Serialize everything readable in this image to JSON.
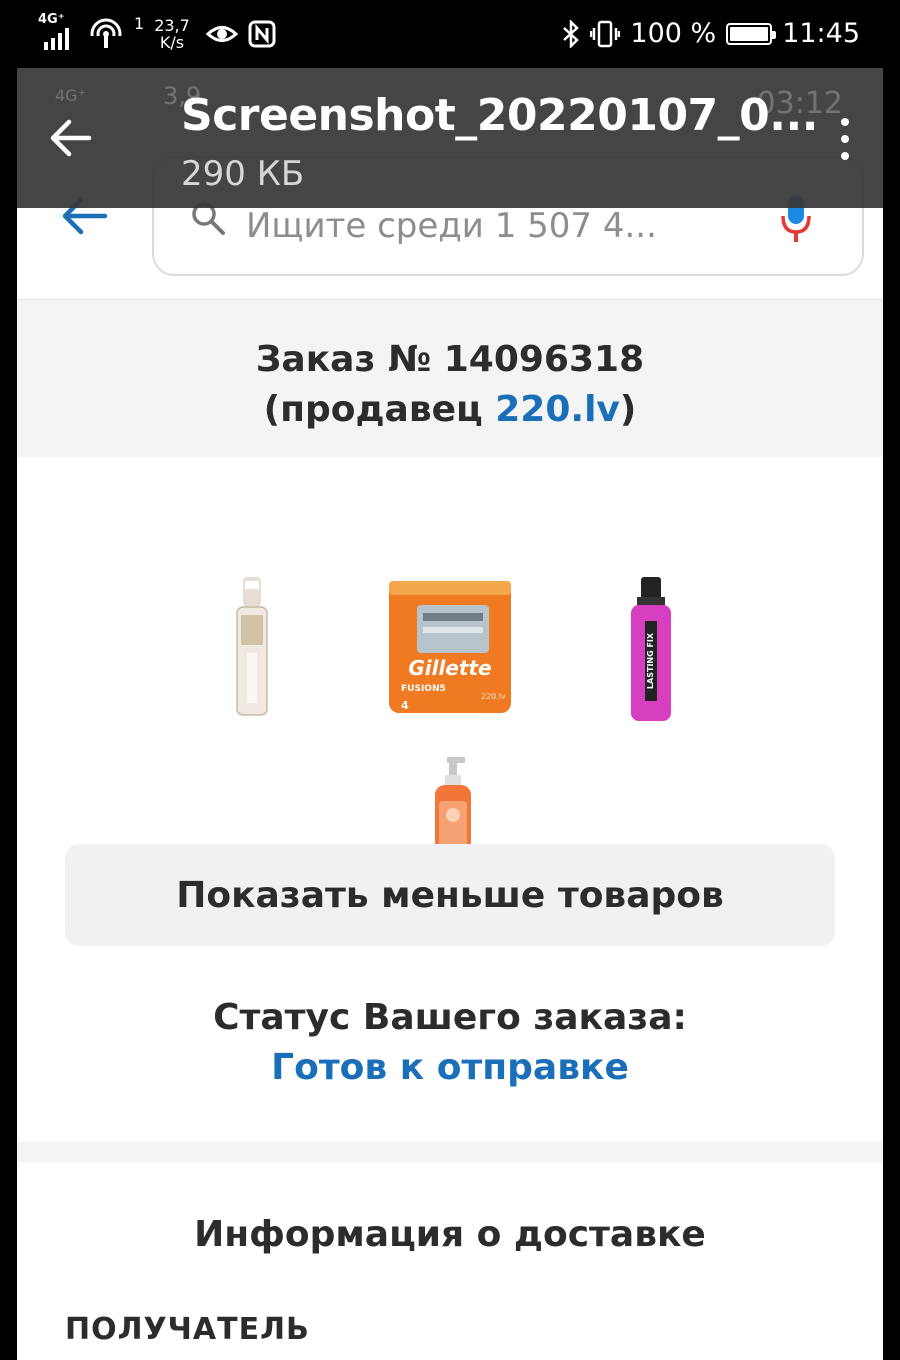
{
  "status_bar": {
    "network_type": "4G⁺",
    "sim_slot": "1",
    "data_speed_value": "23,7",
    "data_speed_unit": "K/s",
    "battery_percent": "100 %",
    "time": "11:45",
    "icons": [
      "signal-icon",
      "hotspot-icon",
      "eye-icon",
      "nfc-icon",
      "bluetooth-icon",
      "vibrate-icon",
      "battery-icon"
    ]
  },
  "viewer": {
    "file_name": "Screenshot_20220107_0...",
    "file_size": "290 КБ",
    "ghost_time": "03:12",
    "ghost_speed": "3,9"
  },
  "search": {
    "placeholder": "Ищите среди 1 507 4..."
  },
  "order": {
    "title": "Заказ № 14096318",
    "seller_prefix": "(продавец ",
    "seller_name": "220.lv",
    "seller_suffix": ")"
  },
  "products": [
    {
      "name": "perfume-bottle"
    },
    {
      "name": "gillette-razor-blades",
      "brand": "Gillette",
      "model": "FUSION5",
      "count": "4",
      "watermark": "220.lv"
    },
    {
      "name": "lasting-fix-spray",
      "label": "LASTING FIX"
    },
    {
      "name": "face-cleanser"
    }
  ],
  "show_less_label": "Показать меньше товаров",
  "status": {
    "label": "Статус Вашего заказа:",
    "value": "Готов к отправке"
  },
  "delivery": {
    "title": "Информация о доставке",
    "recipient_label": "ПОЛУЧАТЕЛЬ"
  },
  "colors": {
    "link_blue": "#1a6fb8",
    "mic_red": "#e53935",
    "mic_blue": "#1e88e5",
    "razor_orange": "#f07a22"
  }
}
